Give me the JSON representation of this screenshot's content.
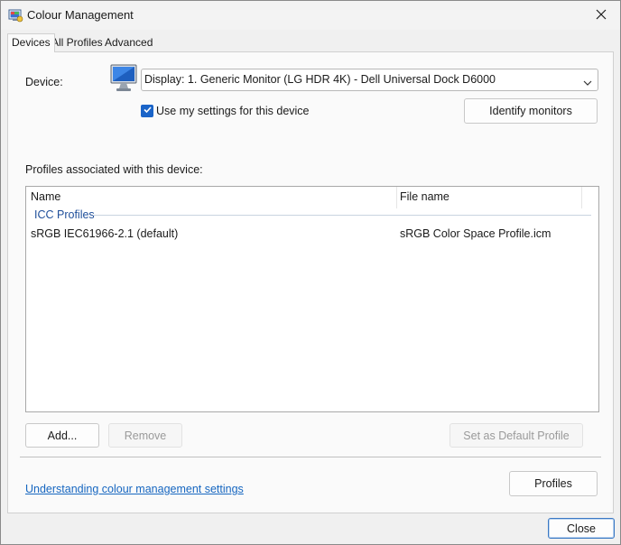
{
  "window": {
    "title": "Colour Management",
    "close_glyph": "✕",
    "app_icon": "colour-management-icon"
  },
  "tabs": [
    {
      "label": "Devices",
      "active": true
    },
    {
      "label": "All Profiles",
      "active": false
    },
    {
      "label": "Advanced",
      "active": false
    }
  ],
  "device": {
    "label": "Device:",
    "icon": "monitor-icon",
    "selected": "Display: 1. Generic Monitor (LG HDR 4K) - Dell Universal Dock D6000",
    "use_my_settings_label": "Use my settings for this device",
    "use_my_settings_checked": true,
    "identify_button": "Identify monitors"
  },
  "profiles": {
    "section_label": "Profiles associated with this device:",
    "columns": [
      "Name",
      "File name"
    ],
    "group": "ICC Profiles",
    "rows": [
      {
        "name": "sRGB IEC61966-2.1 (default)",
        "file": "sRGB Color Space Profile.icm"
      }
    ]
  },
  "actions": {
    "add": "Add...",
    "remove": "Remove",
    "set_default": "Set as Default Profile",
    "profiles": "Profiles"
  },
  "footer": {
    "link": "Understanding colour management settings",
    "close": "Close"
  },
  "colors": {
    "accent": "#1a64c8",
    "link": "#1666c0",
    "group_header": "#1f4f9a"
  }
}
